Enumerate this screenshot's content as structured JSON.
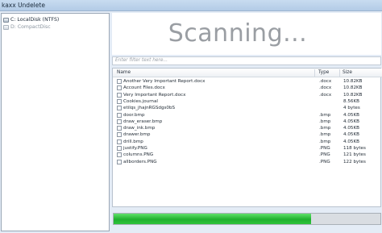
{
  "window": {
    "title": "kaxx Undelete"
  },
  "drives": [
    {
      "label": "C: LocalDisk (NTFS)"
    },
    {
      "label": "D: CompactDisc"
    }
  ],
  "status": {
    "text": "Scanning..."
  },
  "filter": {
    "placeholder": "Enter filter text here..."
  },
  "columns": {
    "name": "Name",
    "type": "Type",
    "size": "Size"
  },
  "files": [
    {
      "name": "Another Very Important Report.docx",
      "type": ".docx",
      "size": "10.82KB"
    },
    {
      "name": "Account Files.docx",
      "type": ".docx",
      "size": "10.82KB"
    },
    {
      "name": "Very Important Report.docx",
      "type": ".docx",
      "size": "10.82KB"
    },
    {
      "name": "Cookies.journal",
      "type": "",
      "size": "8.56KB"
    },
    {
      "name": "etilqs_jhajnRGSdgs0bS",
      "type": "",
      "size": "4 bytes"
    },
    {
      "name": "door.bmp",
      "type": ".bmp",
      "size": "4.05KB"
    },
    {
      "name": "draw_eraser.bmp",
      "type": ".bmp",
      "size": "4.05KB"
    },
    {
      "name": "draw_ink.bmp",
      "type": ".bmp",
      "size": "4.05KB"
    },
    {
      "name": "drawer.bmp",
      "type": ".bmp",
      "size": "4.05KB"
    },
    {
      "name": "drill.bmp",
      "type": ".bmp",
      "size": "4.05KB"
    },
    {
      "name": "justify.PNG",
      "type": ".PNG",
      "size": "118 bytes"
    },
    {
      "name": "columns.PNG",
      "type": ".PNG",
      "size": "121 bytes"
    },
    {
      "name": "allborders.PNG",
      "type": ".PNG",
      "size": "122 bytes"
    }
  ],
  "progress": {
    "value": 0.74,
    "color": "#22b531"
  }
}
